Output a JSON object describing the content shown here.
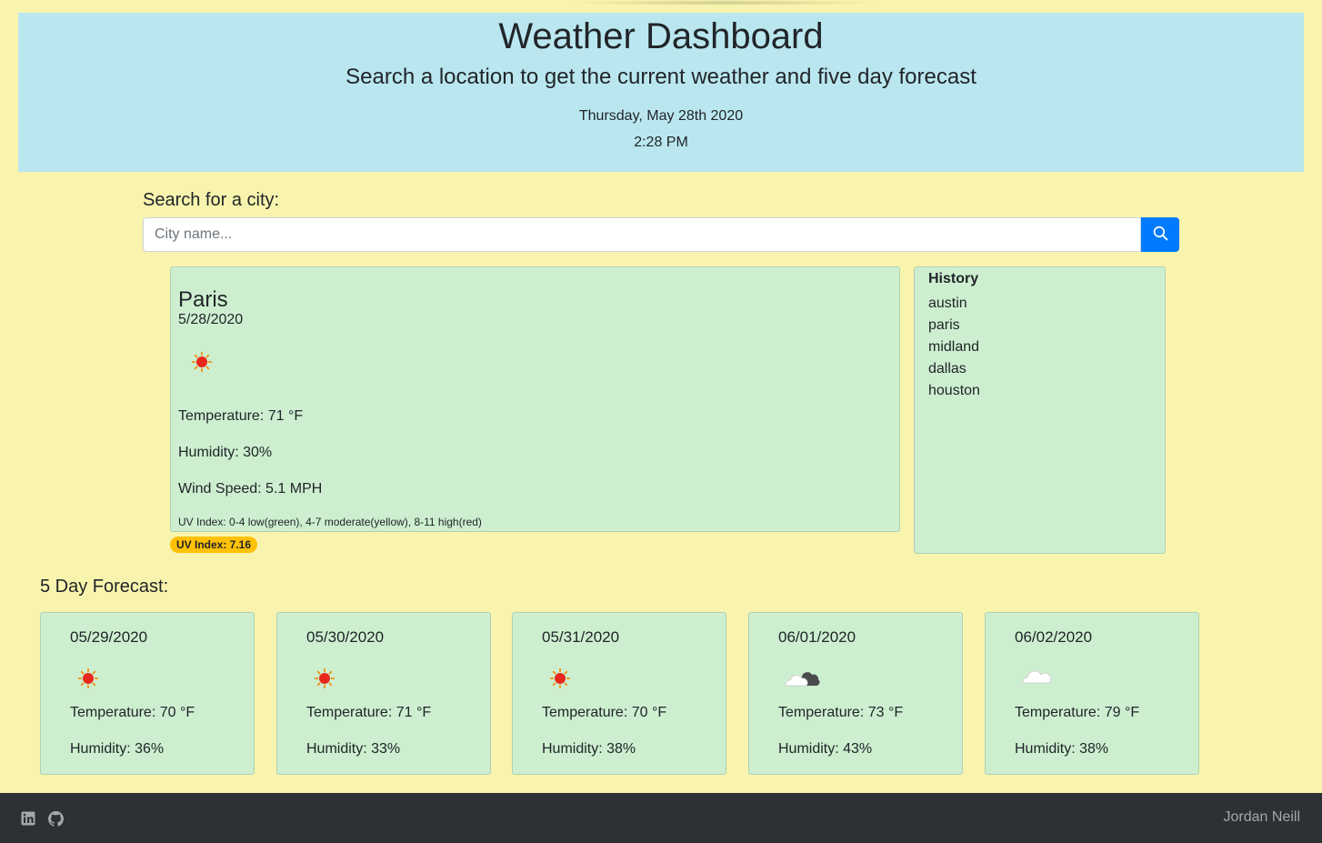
{
  "header": {
    "title": "Weather Dashboard",
    "subtitle": "Search a location to get the current weather and five day forecast",
    "date": "Thursday, May 28th 2020",
    "time": "2:28 PM"
  },
  "search": {
    "label": "Search for a city:",
    "placeholder": "City name...",
    "value": "",
    "button_icon": "search-icon"
  },
  "current": {
    "city": "Paris",
    "date": "5/28/2020",
    "icon": "sun-icon",
    "temperature": "Temperature: 71 °F",
    "humidity": "Humidity: 30%",
    "wind": "Wind Speed: 5.1 MPH",
    "uv_note": "UV Index: 0-4 low(green), 4-7 moderate(yellow), 8-11 high(red)",
    "uv_badge": "UV Index: 7.16",
    "uv_color": "#ffc107"
  },
  "history": {
    "title": "History",
    "items": [
      "austin",
      "paris",
      "midland",
      "dallas",
      "houston"
    ]
  },
  "forecast": {
    "label": "5 Day Forecast:",
    "days": [
      {
        "date": "05/29/2020",
        "icon": "sun-icon",
        "temperature": "Temperature: 70 °F",
        "humidity": "Humidity: 36%"
      },
      {
        "date": "05/30/2020",
        "icon": "sun-icon",
        "temperature": "Temperature: 71 °F",
        "humidity": "Humidity: 33%"
      },
      {
        "date": "05/31/2020",
        "icon": "sun-icon",
        "temperature": "Temperature: 70 °F",
        "humidity": "Humidity: 38%"
      },
      {
        "date": "06/01/2020",
        "icon": "broken-clouds-icon",
        "temperature": "Temperature: 73 °F",
        "humidity": "Humidity: 43%"
      },
      {
        "date": "06/02/2020",
        "icon": "cloud-icon",
        "temperature": "Temperature: 79 °F",
        "humidity": "Humidity: 38%"
      }
    ]
  },
  "footer": {
    "author": "Jordan Neill",
    "icons": [
      "linkedin-icon",
      "github-icon"
    ]
  },
  "colors": {
    "page_bg": "#f8f4ad",
    "header_bg": "#bae7ef",
    "card_bg": "#cdefd0",
    "button": "#007bff",
    "footer_bg": "#2d3035"
  }
}
